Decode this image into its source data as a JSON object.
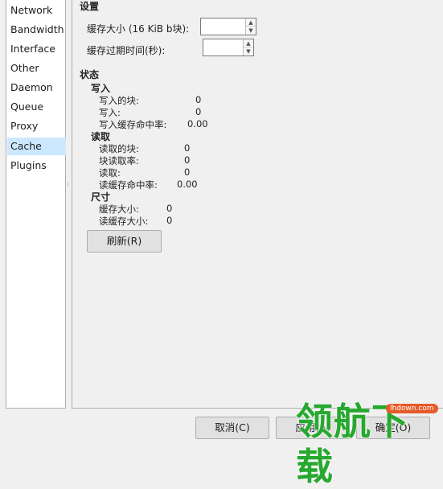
{
  "sidebar": {
    "items": [
      {
        "label": "Network"
      },
      {
        "label": "Bandwidth"
      },
      {
        "label": "Interface"
      },
      {
        "label": "Other"
      },
      {
        "label": "Daemon"
      },
      {
        "label": "Queue"
      },
      {
        "label": "Proxy"
      },
      {
        "label": "Cache"
      },
      {
        "label": "Plugins"
      }
    ],
    "selected": "Cache",
    "selected_color": "#cce8ff"
  },
  "settings": {
    "title": "设置",
    "cache_size_label": "缓存大小 (16 KiB b块):",
    "cache_size_value": "",
    "cache_expiry_label": "缓存过期时间(秒):",
    "cache_expiry_value": ""
  },
  "status": {
    "title": "状态",
    "write": {
      "title": "写入",
      "blocks_written_label": "写入的块:",
      "blocks_written_value": "0",
      "writes_label": "写入:",
      "writes_value": "0",
      "write_hit_ratio_label": "写入缓存命中率:",
      "write_hit_ratio_value": "0.00"
    },
    "read": {
      "title": "读取",
      "blocks_read_label": "读取的块:",
      "blocks_read_value": "0",
      "block_read_rate_label": "块读取率:",
      "block_read_rate_value": "0",
      "reads_label": "读取:",
      "reads_value": "0",
      "read_hit_ratio_label": "读缓存命中率:",
      "read_hit_ratio_value": "0.00"
    },
    "size": {
      "title": "尺寸",
      "cache_size_label": "缓存大小:",
      "cache_size_value": "0",
      "read_cache_size_label": "读缓存大小:",
      "read_cache_size_value": "0"
    },
    "refresh_label": "刷新(R)"
  },
  "footer": {
    "cancel_label": "取消(C)",
    "apply_label": "应用(A)",
    "ok_label": "确定(O)"
  },
  "watermark": {
    "text": "领航下载",
    "url": "lhdown.com",
    "color": "#27a82f"
  }
}
